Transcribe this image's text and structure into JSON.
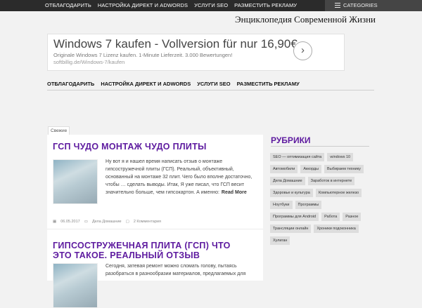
{
  "topbar": {
    "nav": [
      "Отблагодарить",
      "Настройка Директ и AdWords",
      "Услуги SEO",
      "Разместить рекламу"
    ],
    "categories_label": "CATEGORIES"
  },
  "site_title": "Энциклопедия Современной Жизни",
  "ad": {
    "title": "Windows 7 kaufen - Vollversion für nur 16,90€",
    "description": "Originale Windows 7 Lizenz kaufen. 1-Minute Lieferzeit. 3.000 Bewertungen!",
    "url": "softbillig.de/Windows-7/kaufen",
    "arrow": "›"
  },
  "mainnav": [
    "Отблагодарить",
    "Настройка Директ и AdWords",
    "Услуги SEO",
    "Разместить рекламу"
  ],
  "fresh_label": "Свежие",
  "posts": [
    {
      "title": "ГСП чудо монтаж чудо плиты",
      "excerpt": "Ну вот я и нашел время написать отзыв о монтаже гипсостружечной плиты (ГСП). Реальный, объективный, основанный на монтаже 32 плит. Чего было вполне достаточно, чтобы … сделать выводы. Итак, Я уже писал, что ГСП весит значительно больше, чем гипсокартон. А именно:",
      "readmore": "Read More",
      "date": "06.05.2017",
      "category": "Дела Домашние",
      "comments": "2 Комментария"
    },
    {
      "title": "Гипсостружечная плита (ГСП) что это такое. Реальный отзыв",
      "excerpt": "Сегодня, затевая ремонт можно сломать голову, пытаясь разобраться в разнообразии материалов, предлагаемых для"
    }
  ],
  "sidebar": {
    "title": "Рубрики",
    "tags": [
      "SEO — оптимизация сайта",
      "windows 10",
      "Автомобили",
      "Аккорды",
      "Выбираем технику",
      "Дела Домашние",
      "Заработок в интернете",
      "Здоровье и культура",
      "Компьютерное железо",
      "Ноутбуки",
      "Программы",
      "Программы для Android",
      "Работа",
      "Разное",
      "Трансляции онлайн",
      "Хроники подоконника",
      "Хулиган"
    ]
  },
  "colors": {
    "accent": "#5d1a9f",
    "topbar": "#2b2b2b"
  }
}
